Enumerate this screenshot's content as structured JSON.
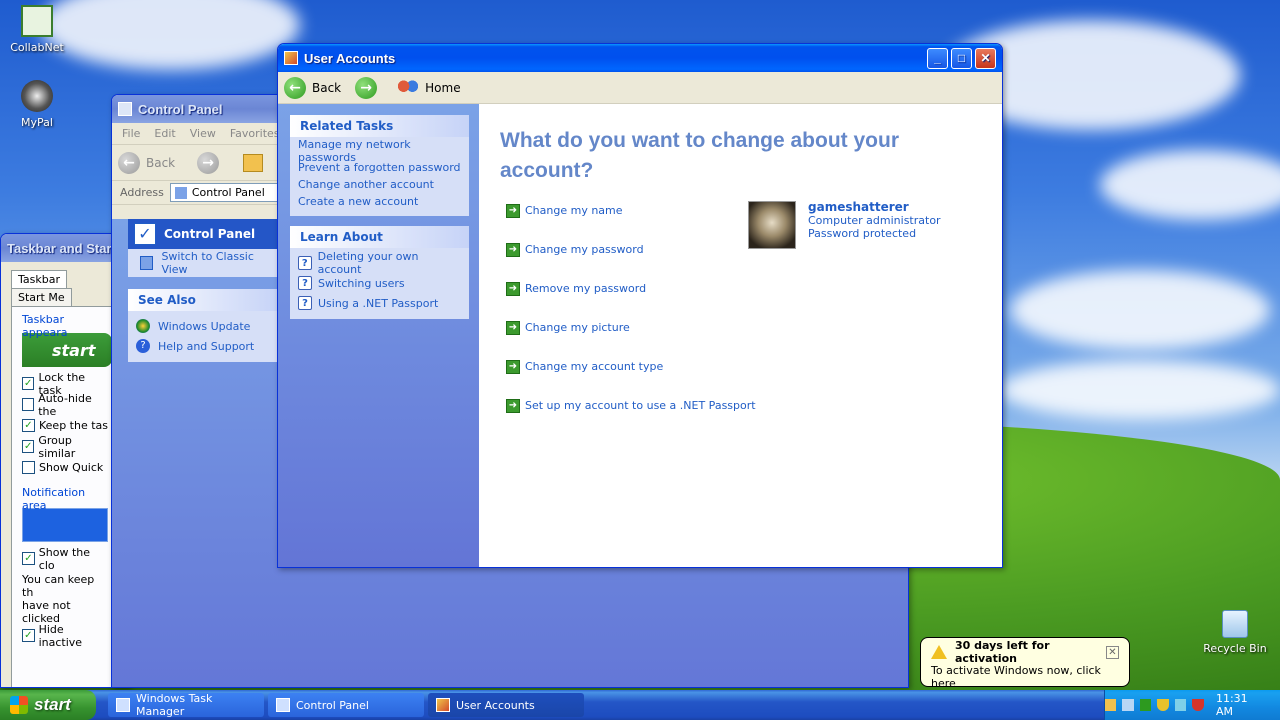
{
  "desktop": {
    "icons": [
      {
        "label": "CollabNet",
        "icon": "collabnet-icon"
      },
      {
        "label": "MyPal",
        "icon": "mypal-icon"
      },
      {
        "label": "Recycle Bin",
        "icon": "recycle-bin-icon"
      }
    ]
  },
  "taskbar_props": {
    "title": "Taskbar and Start",
    "tabs": [
      "Taskbar",
      "Start Me"
    ],
    "section1": "Taskbar appeara",
    "start_preview": "start",
    "checks": [
      {
        "label": "Lock the task",
        "checked": true
      },
      {
        "label": "Auto-hide the",
        "checked": false
      },
      {
        "label": "Keep the tas",
        "checked": true
      },
      {
        "label": "Group similar",
        "checked": true
      },
      {
        "label": "Show Quick",
        "checked": false
      }
    ],
    "section2": "Notification area",
    "show_clock": {
      "label": "Show the clo",
      "checked": true
    },
    "note_line1": "You can keep th",
    "note_line2": "have not clicked",
    "hide_inactive": {
      "label": "Hide inactive",
      "checked": true
    }
  },
  "control_panel": {
    "title": "Control Panel",
    "menu": [
      "File",
      "Edit",
      "View",
      "Favorites"
    ],
    "back_label": "Back",
    "address_label": "Address",
    "address_value": "Control Panel",
    "panel_title": "Control Panel",
    "switch_view": "Switch to Classic View",
    "see_also_head": "See Also",
    "see_also": [
      "Windows Update",
      "Help and Support"
    ]
  },
  "user_accounts": {
    "title": "User Accounts",
    "back_label": "Back",
    "home_label": "Home",
    "related_head": "Related Tasks",
    "related": [
      "Manage my network passwords",
      "Prevent a forgotten password",
      "Change another account",
      "Create a new account"
    ],
    "learn_head": "Learn About",
    "learn": [
      "Deleting your own account",
      "Switching users",
      "Using a .NET Passport"
    ],
    "heading": "What do you want to change about your account?",
    "actions": [
      "Change my name",
      "Change my password",
      "Remove my password",
      "Change my picture",
      "Change my account type",
      "Set up my account to use a .NET Passport"
    ],
    "user": {
      "name": "gameshatterer",
      "role": "Computer administrator",
      "status": "Password protected"
    }
  },
  "balloon": {
    "title": "30 days left for activation",
    "text": "To activate Windows now, click here"
  },
  "taskbar": {
    "start": "start",
    "items": [
      "Windows Task Manager",
      "Control Panel",
      "User Accounts"
    ],
    "clock": "11:31 AM"
  }
}
